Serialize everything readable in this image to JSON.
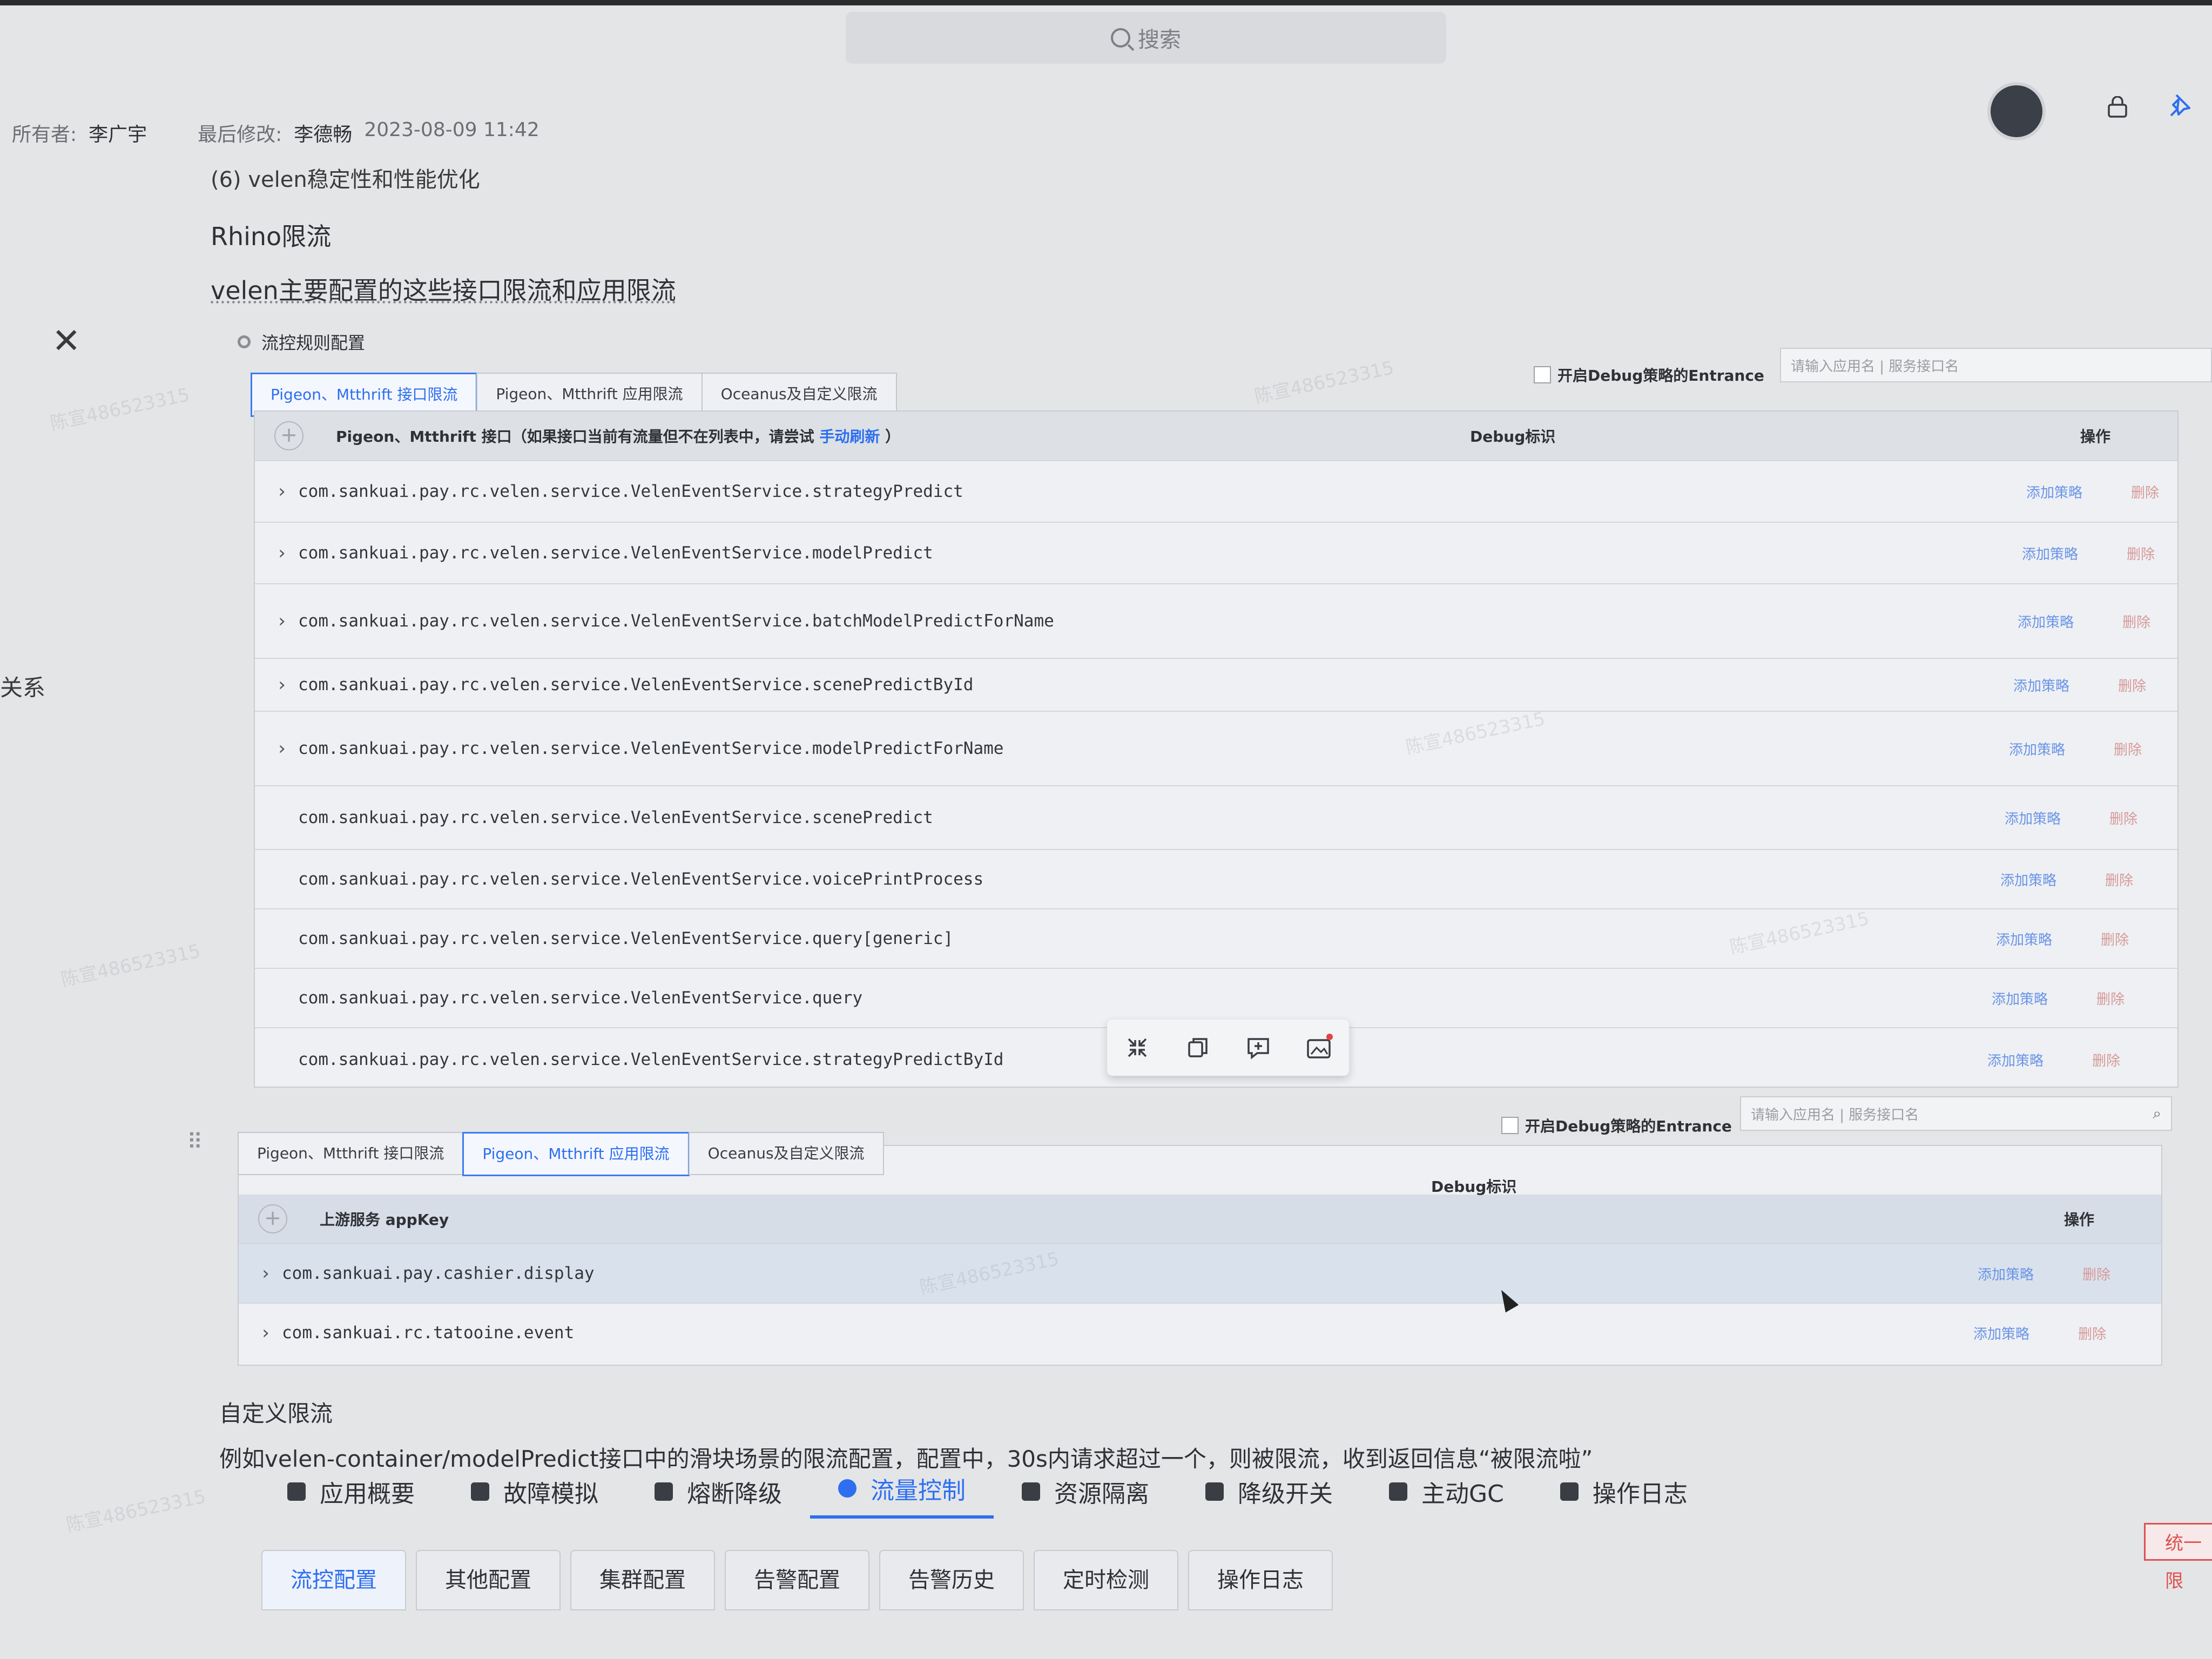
{
  "search": {
    "placeholder": "搜索"
  },
  "meta": {
    "owner_label": "所有者:",
    "owner": "李广宇",
    "modified_label": "最后修改:",
    "modified_by": "李德畅",
    "modified_time": "2023-08-09 11:42"
  },
  "side": {
    "text": "关系"
  },
  "doc": {
    "line1": "(6) velen稳定性和性能优化",
    "heading": "Rhino限流",
    "desc": "velen主要配置的这些接口限流和应用限流",
    "rule_header": "流控规则配置",
    "custom_heading": "自定义限流",
    "custom_desc": "例如velen-container/modelPredict接口中的滑块场景的限流配置，配置中，30s内请求超过一个，则被限流，收到返回信息“被限流啦”"
  },
  "panel1": {
    "tabs": [
      "Pigeon、Mtthrift 接口限流",
      "Pigeon、Mtthrift 应用限流",
      "Oceanus及自定义限流"
    ],
    "debug_checkbox": "开启Debug策略的Entrance",
    "search_placeholder": "请输入应用名 | 服务接口名",
    "header_col1": "Pigeon、Mtthrift 接口（如果接口当前有流量但不在列表中，请尝试 ",
    "header_link": "手动刷新",
    "header_col1_end": " ）",
    "header_debug": "Debug标识",
    "header_op": "操作",
    "rows": [
      {
        "name": "com.sankuai.pay.rc.velen.service.VelenEventService.strategyPredict",
        "expand": true
      },
      {
        "name": "com.sankuai.pay.rc.velen.service.VelenEventService.modelPredict",
        "expand": true
      },
      {
        "name": "com.sankuai.pay.rc.velen.service.VelenEventService.batchModelPredictForName",
        "expand": true
      },
      {
        "name": "com.sankuai.pay.rc.velen.service.VelenEventService.scenePredictById",
        "expand": true
      },
      {
        "name": "com.sankuai.pay.rc.velen.service.VelenEventService.modelPredictForName",
        "expand": true
      },
      {
        "name": "com.sankuai.pay.rc.velen.service.VelenEventService.scenePredict",
        "expand": false
      },
      {
        "name": "com.sankuai.pay.rc.velen.service.VelenEventService.voicePrintProcess",
        "expand": false
      },
      {
        "name": "com.sankuai.pay.rc.velen.service.VelenEventService.query[generic]",
        "expand": false
      },
      {
        "name": "com.sankuai.pay.rc.velen.service.VelenEventService.query",
        "expand": false
      },
      {
        "name": "com.sankuai.pay.rc.velen.service.VelenEventService.strategyPredictById",
        "expand": false
      }
    ],
    "add_label": "添加策略",
    "del_label": "删除"
  },
  "panel2": {
    "tabs": [
      "Pigeon、Mtthrift 接口限流",
      "Pigeon、Mtthrift 应用限流",
      "Oceanus及自定义限流"
    ],
    "debug_checkbox": "开启Debug策略的Entrance",
    "search_placeholder": "请输入应用名 | 服务接口名",
    "header_col1": "上游服务 appKey",
    "header_debug": "Debug标识",
    "header_op": "操作",
    "rows": [
      {
        "name": "com.sankuai.pay.cashier.display"
      },
      {
        "name": "com.sankuai.rc.tatooine.event"
      }
    ],
    "add_label": "添加策略",
    "del_label": "删除"
  },
  "nav": {
    "items": [
      "应用概要",
      "故障模拟",
      "熔断降级",
      "流量控制",
      "资源隔离",
      "降级开关",
      "主动GC",
      "操作日志"
    ],
    "active_index": 3
  },
  "subtabs": {
    "items": [
      "流控配置",
      "其他配置",
      "集群配置",
      "告警配置",
      "告警历史",
      "定时检测",
      "操作日志"
    ],
    "active_index": 0
  },
  "badge": {
    "text": "统一限"
  },
  "watermark": {
    "text": "陈宣486523315"
  },
  "colors": {
    "accent": "#2d6ff0",
    "danger": "#e05050"
  }
}
